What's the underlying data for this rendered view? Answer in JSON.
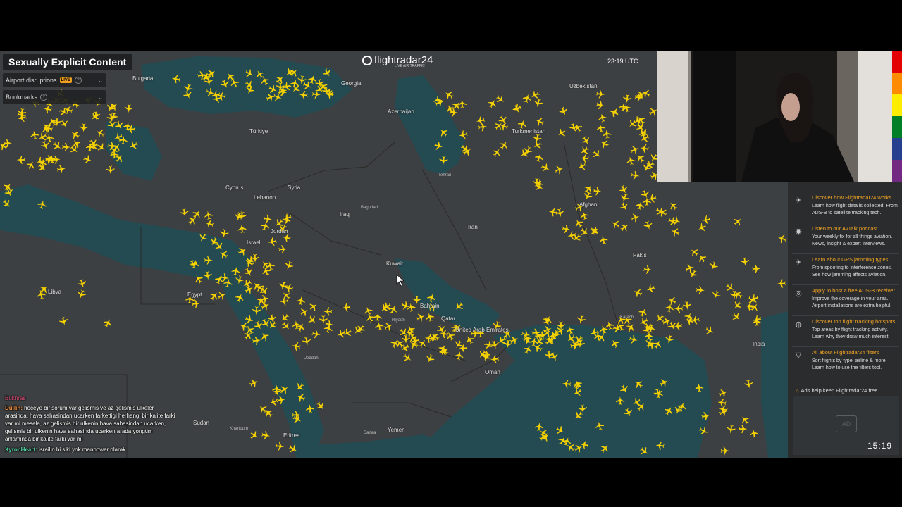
{
  "overlay_title": "Sexually Explicit Content",
  "panel": {
    "airport_disruptions": "Airport disruptions",
    "live_badge": "LIVE",
    "bookmarks": "Bookmarks"
  },
  "logo": {
    "name": "flightradar24",
    "tagline": "LIVE AIR TRAFFIC"
  },
  "utc_time": "23:19 UTC",
  "map_labels": {
    "bulgaria": "Bulgaria",
    "georgia": "Georgia",
    "azerbaijan": "Azerbaijan",
    "uzbekistan": "Uzbekistan",
    "turkmenistan": "Turkmenistan",
    "turkey": "Türkiye",
    "syria": "Syria",
    "cyprus": "Cyprus",
    "lebanon": "Lebanon",
    "iraq": "Iraq",
    "iran": "Iran",
    "afghanistan": "Afghani",
    "pakistan": "Pakis",
    "israel": "Israel",
    "jordan": "Jordan",
    "kuwait": "Kuwait",
    "bahrain": "Bahrain",
    "qatar": "Qatar",
    "uae": "United Arab Emirates",
    "oman": "Oman",
    "egypt": "Egypt",
    "libya": "Libya",
    "sudan": "Sudan",
    "eritrea": "Eritrea",
    "yemen": "Yemen",
    "india": "India",
    "riyadh": "Riyadh",
    "jeddah": "Jeddah",
    "baghdad": "Baghdad",
    "tehran": "Tehran",
    "khartoum": "Khartoum",
    "karachi": "Karachi",
    "sanaa": "Sanaa"
  },
  "promos": [
    {
      "icon": "plane-icon",
      "title": "Discover how Flightradar24 works",
      "desc": "Learn how flight data is collected. From ADS-B to satellite tracking tech."
    },
    {
      "icon": "podcast-icon",
      "title": "Listen to our AvTalk podcast",
      "desc": "Your weekly fix for all things aviation. News, insight & expert interviews."
    },
    {
      "icon": "gps-icon",
      "title": "Learn about GPS jamming types",
      "desc": "From spoofing to interference zones. See how jamming affects aviation."
    },
    {
      "icon": "antenna-icon",
      "title": "Apply to host a free ADS-B receiver",
      "desc": "Improve the coverage in your area. Airport installations are extra helpful."
    },
    {
      "icon": "hotspot-icon",
      "title": "Discover top flight tracking hotspots",
      "desc": "Top areas by flight tracking activity. Learn why they draw much interest."
    },
    {
      "icon": "filter-icon",
      "title": "All about Flightradar24 filters",
      "desc": "Sort flights by type, airline & more. Learn how to use the filters tool."
    }
  ],
  "ads_text": "Ads help keep Flightradar24 free",
  "ad_label": "AD",
  "stream_clock": "15:19",
  "chat": [
    {
      "user": "Bukhras",
      "text": ""
    },
    {
      "user": "Dullin:",
      "text": "hoceye bir sorum var gelismis ve az gelismis ulkeler arasinda, hava sahasindan ucarken farkettigi herhangi bir kalite farki var mi mesela, az gelismis bir ulkenin hava sahasindan ucarken, gelismis bir ulkenin hava sahasinda ucarken arada yongtim anlaminda bir kalite farki var mi"
    },
    {
      "user": "XyronHeart:",
      "text": "israilin bi siki yok manpower olarak"
    }
  ],
  "colors": {
    "plane": "#f5d100",
    "accent": "#f5a623",
    "land": "#3d4042",
    "sea": "#244a52"
  }
}
